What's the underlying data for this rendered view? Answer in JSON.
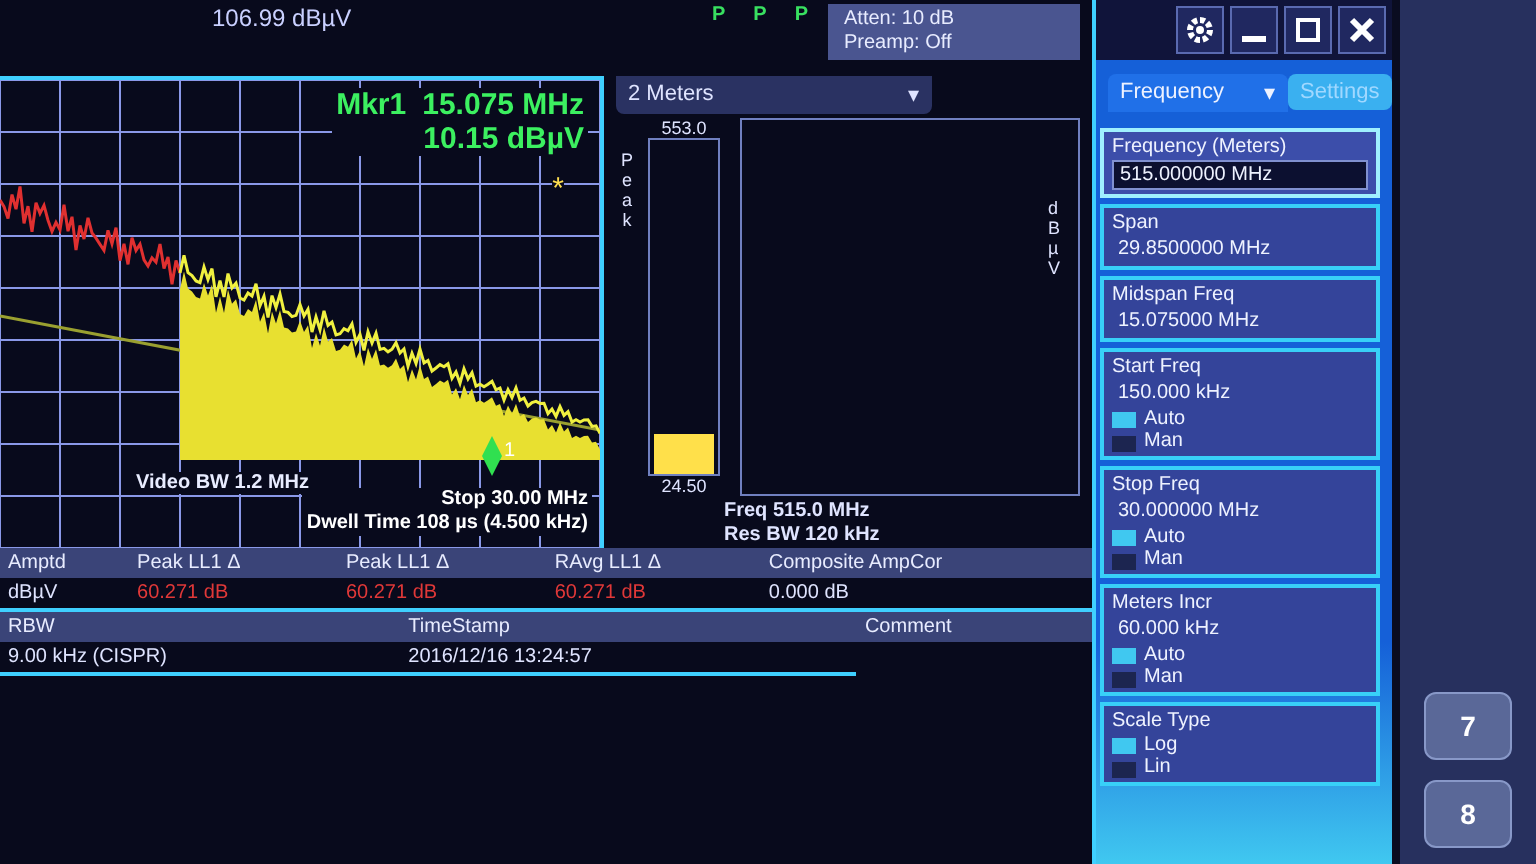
{
  "header": {
    "ref_level": "106.99 dBµV",
    "trace_marks": [
      "P",
      "P",
      "P"
    ],
    "atten": "Atten: 10 dB",
    "preamp": "Preamp: Off"
  },
  "marker": {
    "label": "Mkr1",
    "frequency": "15.075 MHz",
    "amplitude": "10.15 dBµV",
    "symbol": "*",
    "number": "1"
  },
  "graph": {
    "video_bw": "Video BW 1.2 MHz",
    "stop": "Stop 30.00 MHz",
    "dwell": "Dwell Time 108 µs (4.500 kHz)"
  },
  "meter": {
    "dropdown": "2 Meters",
    "caret": "▾",
    "top_value": "553.0",
    "detector": "Peak",
    "unit": "dBµV",
    "level": 0.12,
    "reading": "24.50",
    "freq": "Freq 515.0 MHz",
    "res_bw": "Res BW 120 kHz"
  },
  "limits_table": {
    "columns": [
      "Amptd",
      "Peak LL1 Δ",
      "Peak LL1 Δ",
      "RAvg LL1 Δ",
      "Composite AmpCor"
    ],
    "row": [
      {
        "text": "dBµV",
        "fail": false
      },
      {
        "text": "60.271 dB",
        "fail": true
      },
      {
        "text": "60.271 dB",
        "fail": true
      },
      {
        "text": "60.271 dB",
        "fail": true
      },
      {
        "text": "0.000 dB",
        "fail": false
      }
    ]
  },
  "info_table": {
    "columns": [
      "RBW",
      "TimeStamp",
      "Comment"
    ],
    "row": [
      "9.00 kHz (CISPR)",
      "2016/12/16 13:24:57"
    ]
  },
  "panel": {
    "tabs": [
      {
        "label": "Frequency",
        "caret": "▾",
        "selected": true
      },
      {
        "label": "Settings",
        "selected": false
      }
    ],
    "items": [
      {
        "kind": "value",
        "label": "Frequency (Meters)",
        "value": "515.000000 MHz",
        "selected": true
      },
      {
        "kind": "value",
        "label": "Span",
        "value": "29.8500000 MHz",
        "selected": false
      },
      {
        "kind": "value",
        "label": "Midspan Freq",
        "value": "15.075000 MHz",
        "selected": false
      },
      {
        "kind": "auto",
        "label": "Start Freq",
        "value": "150.000 kHz",
        "selected": false,
        "options": [
          {
            "label": "Auto",
            "selected": true
          },
          {
            "label": "Man",
            "selected": false
          }
        ]
      },
      {
        "kind": "auto",
        "label": "Stop Freq",
        "value": "30.000000 MHz",
        "selected": false,
        "options": [
          {
            "label": "Auto",
            "selected": true
          },
          {
            "label": "Man",
            "selected": false
          }
        ]
      },
      {
        "kind": "auto",
        "label": "Meters Incr",
        "value": "60.000 kHz",
        "selected": false,
        "options": [
          {
            "label": "Auto",
            "selected": true
          },
          {
            "label": "Man",
            "selected": false
          }
        ]
      },
      {
        "kind": "choice",
        "label": "Scale Type",
        "selected": false,
        "options": [
          {
            "label": "Log",
            "selected": true
          },
          {
            "label": "Lin",
            "selected": false
          }
        ]
      }
    ]
  },
  "keypad": [
    "7",
    "8"
  ]
}
